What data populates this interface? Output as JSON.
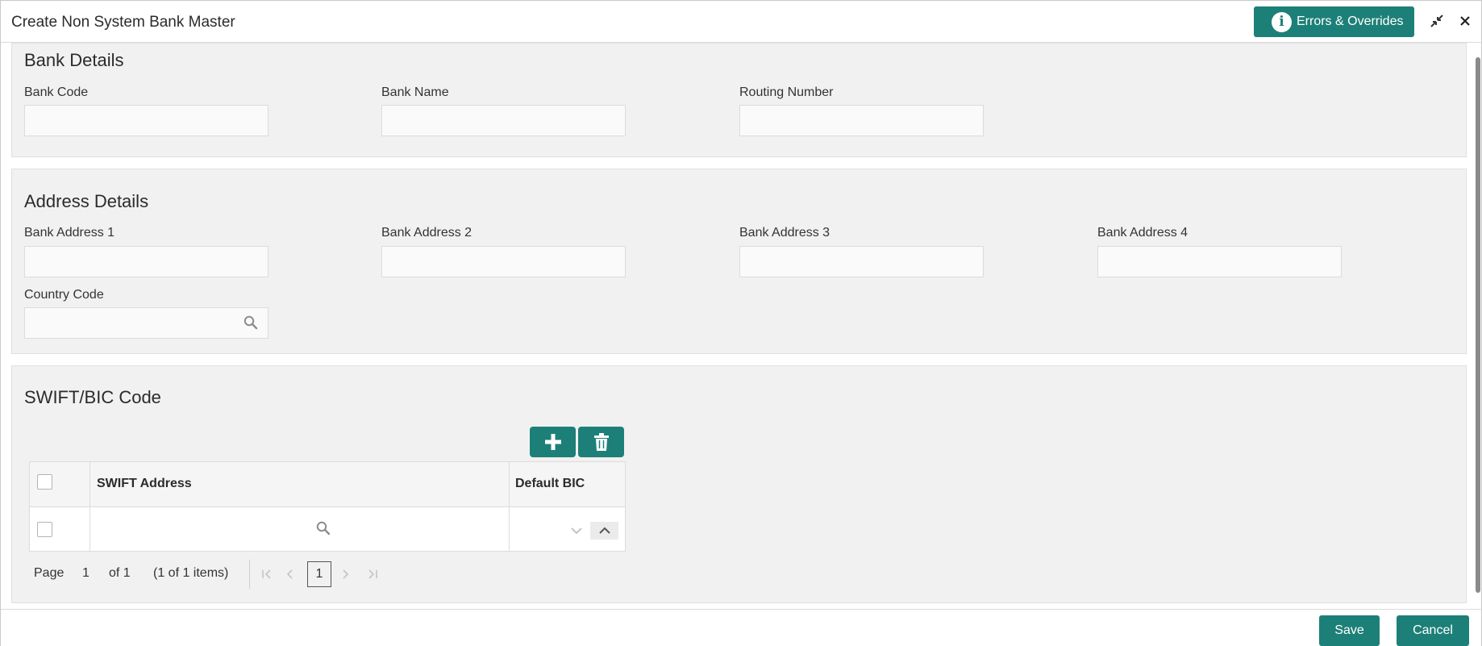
{
  "header": {
    "title": "Create Non System Bank Master",
    "errors_label": "Errors & Overrides"
  },
  "bank_details": {
    "title": "Bank Details",
    "bank_code_label": "Bank Code",
    "bank_code_value": "",
    "bank_name_label": "Bank Name",
    "bank_name_value": "",
    "routing_label": "Routing Number",
    "routing_value": ""
  },
  "address_details": {
    "title": "Address Details",
    "addr1_label": "Bank Address 1",
    "addr2_label": "Bank Address 2",
    "addr3_label": "Bank Address 3",
    "addr4_label": "Bank Address 4",
    "country_label": "Country Code"
  },
  "swift": {
    "title": "SWIFT/BIC Code",
    "columns": [
      "SWIFT Address",
      "Default BIC"
    ],
    "rows": [
      {
        "swift_address": "",
        "default_bic": ""
      }
    ],
    "pager": {
      "page_label": "Page",
      "page_number": "1",
      "of_label": "of 1",
      "items_label": "(1 of 1 items)",
      "current_page": "1"
    }
  },
  "footer": {
    "save_label": "Save",
    "cancel_label": "Cancel"
  },
  "colors": {
    "accent": "#1d8078",
    "section_bg": "#f1f1f1"
  }
}
